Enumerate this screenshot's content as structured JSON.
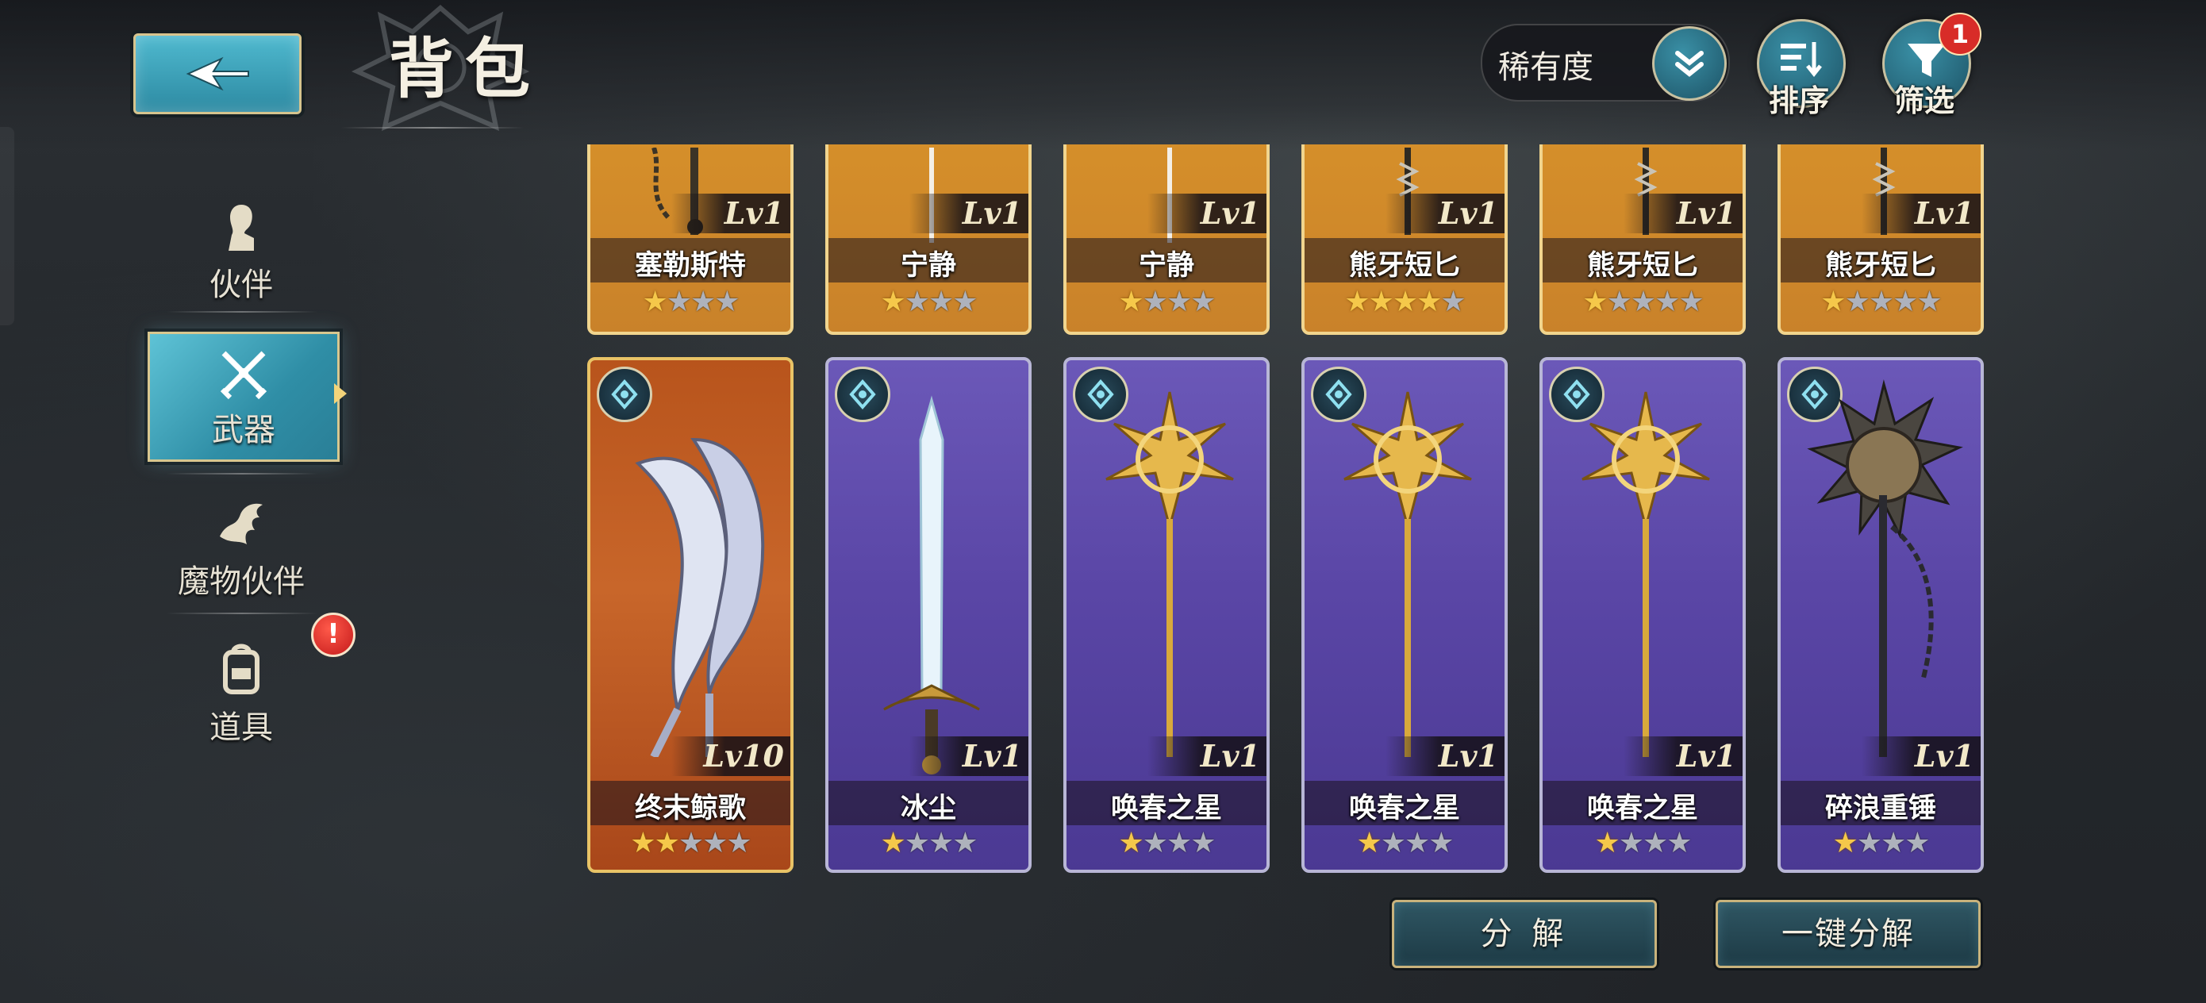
{
  "header": {
    "title": "背包",
    "rarity_select": "稀有度",
    "sort_label": "排序",
    "filter_label": "筛选",
    "filter_badge": "1"
  },
  "sidebar": {
    "items": [
      {
        "label": "伙伴",
        "icon": "companion-icon",
        "active": false
      },
      {
        "label": "武器",
        "icon": "crossed-swords-icon",
        "active": true
      },
      {
        "label": "魔物伙伴",
        "icon": "dragon-icon",
        "active": false
      },
      {
        "label": "道具",
        "icon": "backpack-icon",
        "active": false
      }
    ],
    "alert_badge": "!"
  },
  "cards_top": [
    {
      "name": "塞勒斯特",
      "level": "Lv1",
      "stars": 1,
      "max_stars": 4
    },
    {
      "name": "宁静",
      "level": "Lv1",
      "stars": 1,
      "max_stars": 4
    },
    {
      "name": "宁静",
      "level": "Lv1",
      "stars": 1,
      "max_stars": 4
    },
    {
      "name": "熊牙短匕",
      "level": "Lv1",
      "stars": 4,
      "max_stars": 5
    },
    {
      "name": "熊牙短匕",
      "level": "Lv1",
      "stars": 1,
      "max_stars": 5
    },
    {
      "name": "熊牙短匕",
      "level": "Lv1",
      "stars": 1,
      "max_stars": 5
    }
  ],
  "cards_bottom": [
    {
      "name": "终末鲸歌",
      "level": "Lv10",
      "stars": 2,
      "max_stars": 5,
      "weapon": "twin-scythe-icon"
    },
    {
      "name": "冰尘",
      "level": "Lv1",
      "stars": 1,
      "max_stars": 4,
      "weapon": "sword-icon"
    },
    {
      "name": "唤春之星",
      "level": "Lv1",
      "stars": 1,
      "max_stars": 4,
      "weapon": "star-staff-icon"
    },
    {
      "name": "唤春之星",
      "level": "Lv1",
      "stars": 1,
      "max_stars": 4,
      "weapon": "star-staff-icon"
    },
    {
      "name": "唤春之星",
      "level": "Lv1",
      "stars": 1,
      "max_stars": 4,
      "weapon": "star-staff-icon"
    },
    {
      "name": "碎浪重锤",
      "level": "Lv1",
      "stars": 1,
      "max_stars": 4,
      "weapon": "spiked-flail-icon"
    }
  ],
  "actions": {
    "decompose": "分 解",
    "one_click_decompose": "一键分解"
  },
  "colors": {
    "accent_teal": "#3a9fb8",
    "gold_border": "#d6c48e",
    "card_purple": "#5a46a6",
    "card_orange": "#c8662a",
    "card_gold": "#d6902a",
    "star_gold": "#f5c84a",
    "alert_red": "#d82c28"
  }
}
